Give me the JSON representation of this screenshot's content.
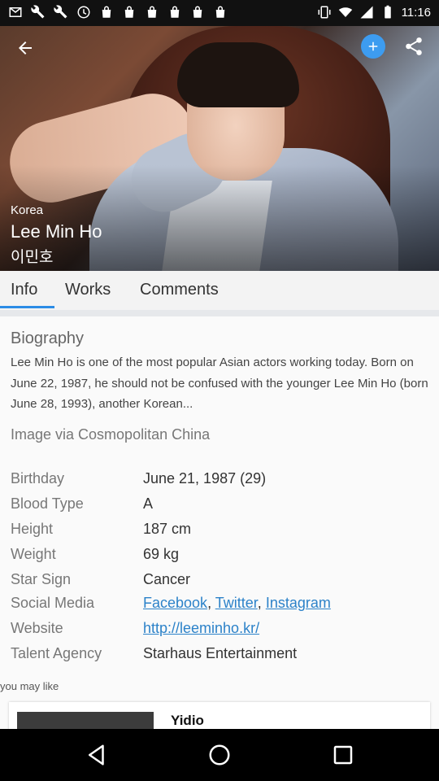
{
  "status_bar": {
    "time": "11:16",
    "left_icons": [
      "mail-icon",
      "wrench-icon",
      "wrench-icon",
      "clock-icon",
      "shopping-bag-icon",
      "shopping-bag-icon",
      "shopping-bag-icon",
      "shopping-bag-icon",
      "shopping-bag-icon",
      "shopping-bag-icon"
    ],
    "right_icons": [
      "vibrate-icon",
      "wifi-icon",
      "signal-icon",
      "battery-icon"
    ]
  },
  "hero": {
    "country": "Korea",
    "name": "Lee Min Ho",
    "native_name": "이민호",
    "accent_color": "#3d9cf0"
  },
  "tabs": [
    {
      "label": "Info",
      "active": true
    },
    {
      "label": "Works",
      "active": false
    },
    {
      "label": "Comments",
      "active": false
    }
  ],
  "biography": {
    "title": "Biography",
    "text": "Lee Min Ho is one of the most popular Asian actors working today. Born on June 22, 1987, he should not be confused with the younger Lee Min Ho (born June 28, 1993), another Korean...",
    "image_credit": "Image via Cosmopolitan China"
  },
  "details": {
    "birthday_label": "Birthday",
    "birthday_value": "June 21, 1987 (29)",
    "blood_type_label": "Blood Type",
    "blood_type_value": "A",
    "height_label": "Height",
    "height_value": "187 cm",
    "weight_label": "Weight",
    "weight_value": "69 kg",
    "star_sign_label": "Star Sign",
    "star_sign_value": "Cancer",
    "social_media_label": "Social Media",
    "social_links": [
      "Facebook",
      "Twitter",
      "Instagram"
    ],
    "social_sep": ",",
    "website_label": "Website",
    "website_value": "http://leeminho.kr/",
    "talent_agency_label": "Talent Agency",
    "talent_agency_value": "Starhaus Entertainment"
  },
  "recommendations": {
    "heading": "you may like",
    "first_title": "Yidio"
  },
  "colors": {
    "link": "#2c82c9",
    "tab_indicator": "#2b8ce6"
  }
}
